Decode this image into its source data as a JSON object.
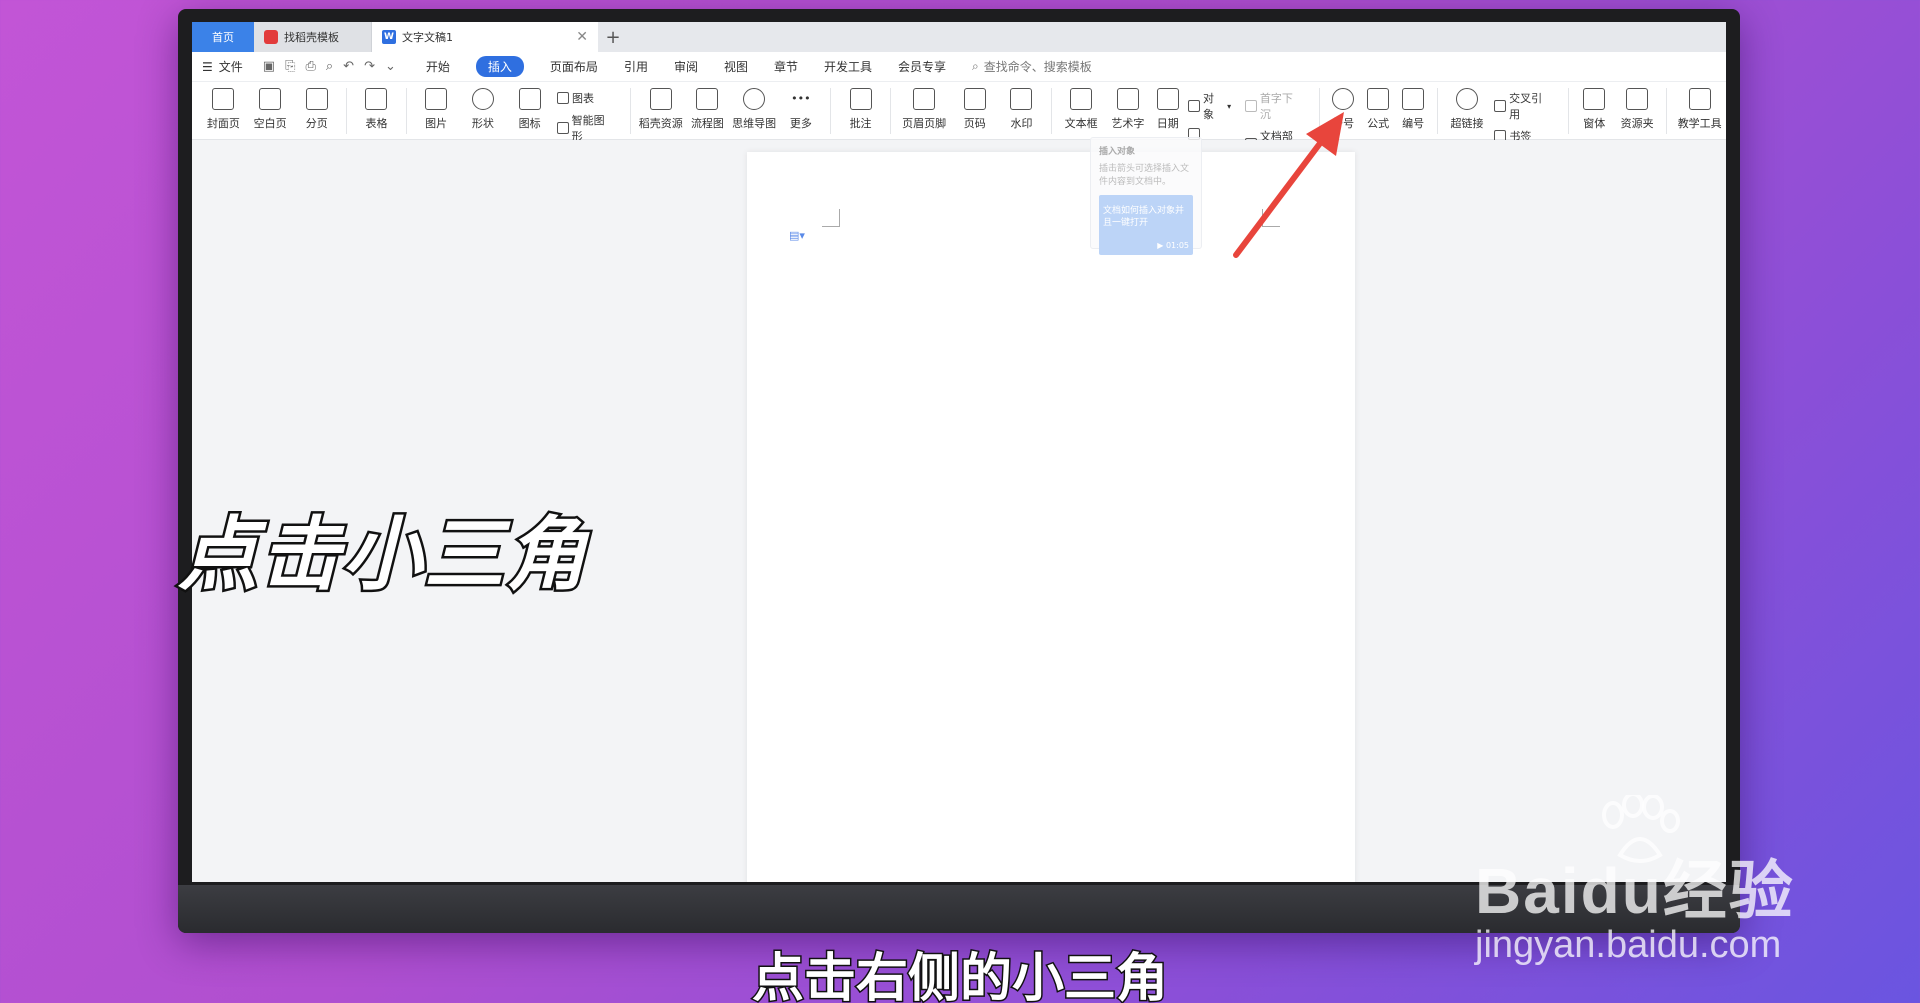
{
  "tabs": {
    "home": "首页",
    "templates": "找稻壳模板",
    "document": "文字文稿1",
    "add": "+"
  },
  "menu": {
    "file": "文件",
    "items": [
      "开始",
      "插入",
      "页面布局",
      "引用",
      "审阅",
      "视图",
      "章节",
      "开发工具",
      "会员专享"
    ],
    "active": "插入",
    "search": "查找命令、搜索模板"
  },
  "ribbon": {
    "cover_page": "封面页",
    "blank_page": "空白页",
    "page_break": "分页",
    "table": "表格",
    "picture": "图片",
    "shape": "形状",
    "icon": "图标",
    "chart": "图表",
    "smart_art": "智能图形",
    "docer_resources": "稻壳资源",
    "flowchart": "流程图",
    "mind_map": "思维导图",
    "more": "更多",
    "comment": "批注",
    "header_footer": "页眉页脚",
    "page_number": "页码",
    "watermark": "水印",
    "text_box": "文本框",
    "word_art": "艺术字",
    "date": "日期",
    "object": "对象",
    "drop_cap": "首字下沉",
    "doc_parts": "文档部件",
    "symbol": "符号",
    "formula": "公式",
    "numbering": "编号",
    "hyperlink": "超链接",
    "cross_ref": "交叉引用",
    "bookmark": "书签",
    "window": "窗体",
    "resource_folder": "资源夹",
    "teaching_tools": "教学工具"
  },
  "tooltip": {
    "title": "插入对象",
    "desc": "插击箭头可选择插入文件内容到文档中。",
    "card": "文档如何插入对象并且一键打开",
    "time": "01:05"
  },
  "overlay": {
    "title": "点击小三角",
    "subtitle": "点击右侧的小三角"
  },
  "watermark": {
    "brand": "Baidu经验",
    "url": "jingyan.baidu.com"
  },
  "colors": {
    "accent": "#2f6fe0",
    "arrow": "#e8453c"
  }
}
